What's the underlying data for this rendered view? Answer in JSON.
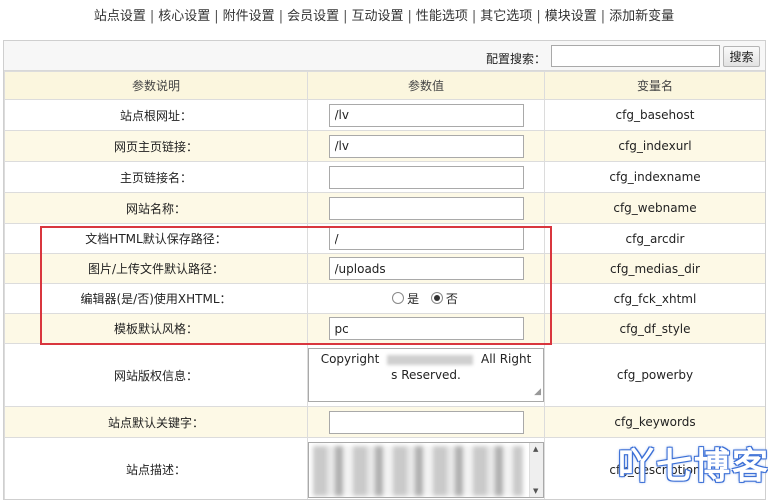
{
  "nav": {
    "links": [
      "站点设置",
      "核心设置",
      "附件设置",
      "会员设置",
      "互动设置",
      "性能选项",
      "其它选项",
      "模块设置",
      "添加新变量"
    ],
    "separator": "|"
  },
  "search": {
    "label": "配置搜索：",
    "value": "",
    "button": "搜索"
  },
  "table": {
    "headers": [
      "参数说明",
      "参数值",
      "变量名"
    ],
    "rows": [
      {
        "label": "站点根网址：",
        "value": "/lv",
        "var": "cfg_basehost"
      },
      {
        "label": "网页主页链接：",
        "value": "/lv",
        "var": "cfg_indexurl"
      },
      {
        "label": "主页链接名：",
        "value": "",
        "var": "cfg_indexname"
      },
      {
        "label": "网站名称：",
        "value": "",
        "var": "cfg_webname"
      },
      {
        "label": "文档HTML默认保存路径：",
        "value": "/",
        "var": "cfg_arcdir"
      },
      {
        "label": "图片/上传文件默认路径：",
        "value": "/uploads",
        "var": "cfg_medias_dir"
      },
      {
        "label": "编辑器(是/否)使用XHTML：",
        "radio_yes": "是",
        "radio_no": "否",
        "selected": "否",
        "var": "cfg_fck_xhtml"
      },
      {
        "label": "模板默认风格：",
        "value": "pc",
        "var": "cfg_df_style"
      },
      {
        "label": "网站版权信息：",
        "value_start": "Copyright",
        "value_end": "All Right",
        "value_line2": "s Reserved.",
        "var": "cfg_powerby"
      },
      {
        "label": "站点默认关键字：",
        "value": "",
        "var": "cfg_keywords"
      },
      {
        "label": "站点描述：",
        "value": "",
        "var": "cfg_description"
      }
    ]
  },
  "watermark": "吖七博客"
}
